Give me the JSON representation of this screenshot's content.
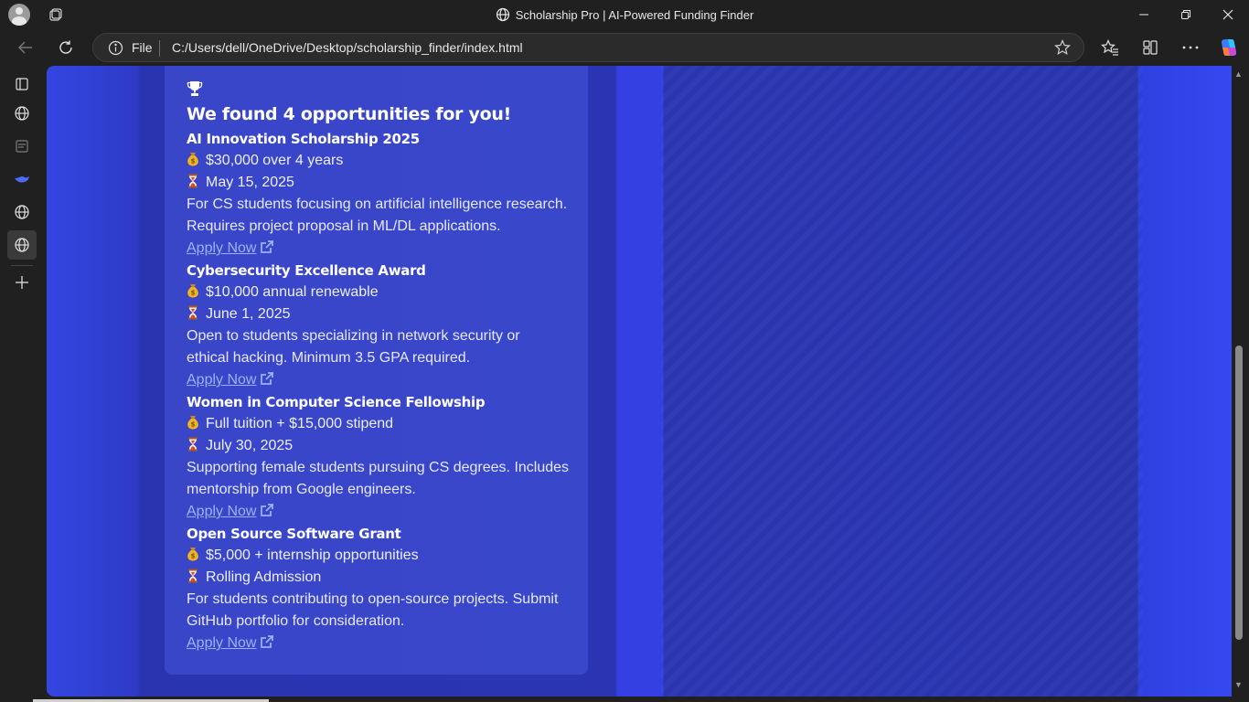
{
  "window": {
    "title": "Scholarship Pro | AI-Powered Funding Finder"
  },
  "addressbar": {
    "scheme_label": "File",
    "url": "C:/Users/dell/OneDrive/Desktop/scholarship_finder/index.html"
  },
  "icons": {
    "profile": "avatar-icon",
    "workspaces": "workspaces-icon",
    "back": "back-arrow-icon",
    "refresh": "refresh-icon",
    "favorite": "star-icon",
    "favorites": "favorites-icon",
    "collections": "collections-icon",
    "more": "ellipsis-icon",
    "copilot": "copilot-icon"
  },
  "page": {
    "headline": "We found 4 opportunities for you!",
    "apply_label": "Apply Now",
    "scholarships": [
      {
        "name": "AI Innovation Scholarship 2025",
        "amount": "$30,000 over 4 years",
        "deadline": "May 15, 2025",
        "description_1": "For CS students focusing on artificial intelligence research.",
        "description_2": "Requires project proposal in ML/DL applications."
      },
      {
        "name": "Cybersecurity Excellence Award",
        "amount": "$10,000 annual renewable",
        "deadline": "June 1, 2025",
        "description_1": "Open to students specializing in network security or",
        "description_2": "ethical hacking. Minimum 3.5 GPA required."
      },
      {
        "name": "Women in Computer Science Fellowship",
        "amount": "Full tuition + $15,000 stipend",
        "deadline": "July 30, 2025",
        "description_1": "Supporting female students pursuing CS degrees. Includes",
        "description_2": "mentorship from Google engineers."
      },
      {
        "name": "Open Source Software Grant",
        "amount": "$5,000 + internship opportunities",
        "deadline": "Rolling Admission",
        "description_1": "For students contributing to open-source projects. Submit",
        "description_2": "GitHub portfolio for consideration."
      }
    ]
  },
  "colors": {
    "page_bg": "#2b35b4",
    "card_bg": "#4655dc",
    "link": "#9fb0ff",
    "browser_chrome": "#202020"
  }
}
